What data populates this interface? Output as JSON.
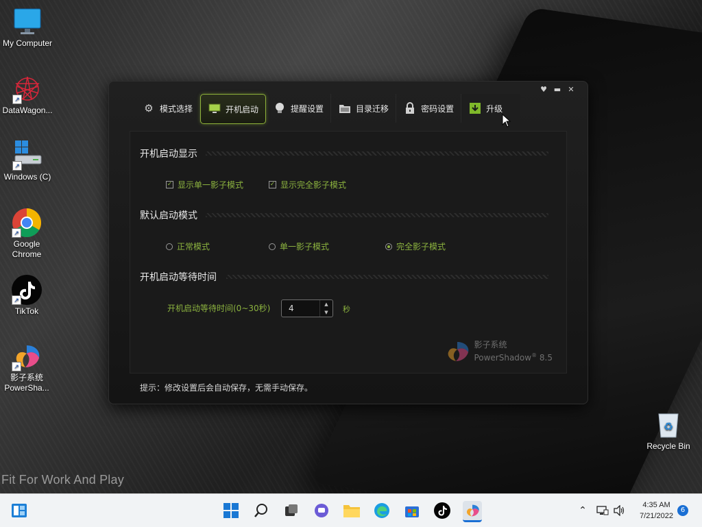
{
  "desktop": {
    "icons": [
      {
        "label": "My Computer"
      },
      {
        "label": "DataWagon..."
      },
      {
        "label": "Windows (C)"
      },
      {
        "label_line1": "Google",
        "label_line2": "Chrome"
      },
      {
        "label": "TikTok"
      },
      {
        "label_line1": "影子系统",
        "label_line2": "PowerSha..."
      },
      {
        "label": "Recycle Bin"
      }
    ],
    "slogan": "Fit For Work And Play"
  },
  "window": {
    "tabs": [
      {
        "label": "模式选择",
        "icon": "gear-icon"
      },
      {
        "label": "开机启动",
        "icon": "monitor-icon"
      },
      {
        "label": "提醒设置",
        "icon": "bulb-icon"
      },
      {
        "label": "目录迁移",
        "icon": "folder-icon"
      },
      {
        "label": "密码设置",
        "icon": "lock-icon"
      },
      {
        "label": "升级",
        "icon": "download-icon"
      }
    ],
    "active_tab": "开机启动",
    "sections": {
      "boot_display": {
        "title": "开机启动显示",
        "options": [
          {
            "label": "显示单一影子模式",
            "checked": true
          },
          {
            "label": "显示完全影子模式",
            "checked": true
          }
        ]
      },
      "default_mode": {
        "title": "默认启动模式",
        "options": [
          {
            "label": "正常模式",
            "selected": false
          },
          {
            "label": "单一影子模式",
            "selected": false
          },
          {
            "label": "完全影子模式",
            "selected": true
          }
        ]
      },
      "wait_time": {
        "title": "开机启动等待时间",
        "field_label": "开机启动等待时间(0~30秒)",
        "value": "4",
        "unit": "秒"
      }
    },
    "brand": {
      "name_cn": "影子系统",
      "name_en": "PowerShadow",
      "version": "8.5",
      "reg": "®"
    },
    "tip": "提示：修改设置后会自动保存，无需手动保存。"
  },
  "taskbar": {
    "time": "4:35 AM",
    "date": "7/21/2022",
    "notification_count": "6"
  },
  "colors": {
    "accent_green": "#8cb33f",
    "taskbar_bg": "#f1f3f5"
  }
}
